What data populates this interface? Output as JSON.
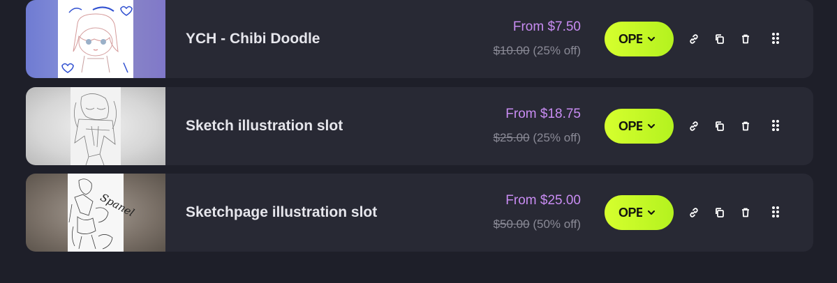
{
  "items": [
    {
      "title": "YCH - Chibi Doodle",
      "price_from": "From $7.50",
      "original_price": "$10.00",
      "discount": "(25% off)",
      "status_label": "OPEN"
    },
    {
      "title": "Sketch illustration slot",
      "price_from": "From $18.75",
      "original_price": "$25.00",
      "discount": "(25% off)",
      "status_label": "OPEN"
    },
    {
      "title": "Sketchpage illustration slot",
      "price_from": "From $25.00",
      "original_price": "$50.00",
      "discount": "(50% off)",
      "status_label": "OPEN"
    }
  ],
  "icons": {
    "link": "link-icon",
    "copy": "copy-icon",
    "delete": "trash-icon",
    "drag": "drag-handle-icon",
    "dropdown": "chevron-down-icon"
  },
  "colors": {
    "background": "#1e1f29",
    "card": "#282934",
    "price_accent": "#c88cf2",
    "status_button": "#c8fa28",
    "title_text": "#e6e6ec",
    "muted_text": "#8a8a96"
  }
}
